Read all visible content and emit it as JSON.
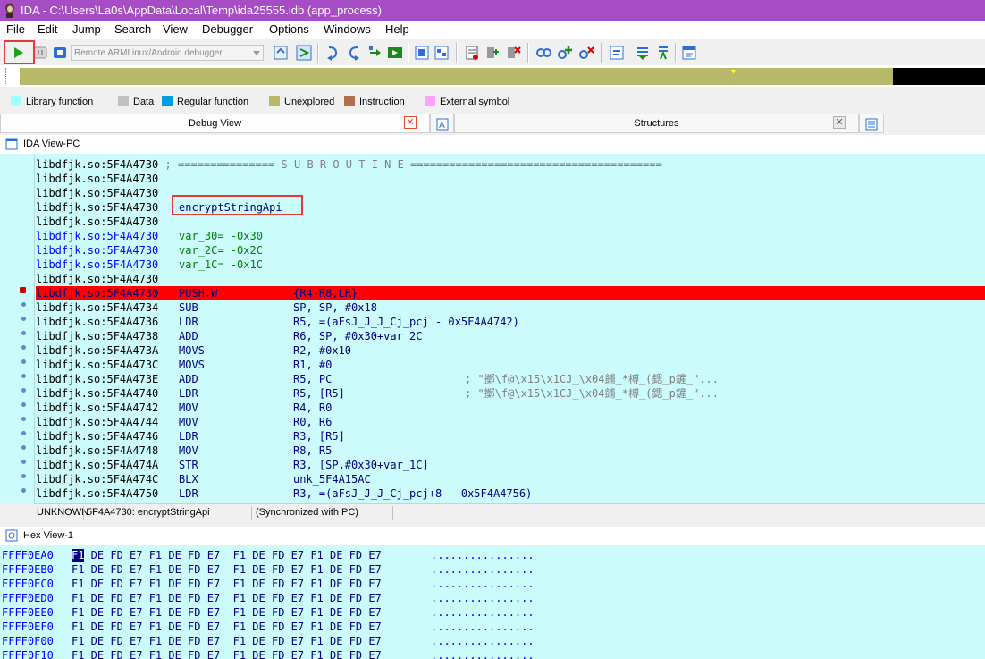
{
  "window": {
    "title": "IDA - C:\\Users\\La0s\\AppData\\Local\\Temp\\ida25555.idb (app_process)"
  },
  "menu": [
    "File",
    "Edit",
    "Jump",
    "Search",
    "View",
    "Debugger",
    "Options",
    "Windows",
    "Help"
  ],
  "toolbar": {
    "debugger_select": "Remote ARMLinux/Android debugger",
    "icons": [
      "play-icon",
      "pause-icon",
      "stop-icon",
      "attach-icon",
      "step-into-icon",
      "step-over-icon",
      "run-to-cursor-icon",
      "step-out-icon",
      "run-until-return-icon",
      "breakpoint-list-icon",
      "threads-icon",
      "modules-icon",
      "add-breakpoint-icon",
      "delete-breakpoint-icon",
      "watch-icon",
      "add-watch-icon",
      "delete-watch-icon",
      "trace-icon",
      "instruction-trace-icon",
      "function-trace-icon",
      "trace-window-icon"
    ]
  },
  "legend": [
    {
      "label": "Library function",
      "color": "#a0ffff"
    },
    {
      "label": "Data",
      "color": "#c0c0c0"
    },
    {
      "label": "Regular function",
      "color": "#00a0e0"
    },
    {
      "label": "Unexplored",
      "color": "#b8b86a"
    },
    {
      "label": "Instruction",
      "color": "#b07050"
    },
    {
      "label": "External symbol",
      "color": "#ffa0ff"
    }
  ],
  "tabs": {
    "debug_view": "Debug View",
    "structures": "Structures"
  },
  "ida_view": {
    "title": "IDA View-PC",
    "lines": [
      {
        "addr": "libdfjk.so:5F4A4730",
        "text": "; =============== S U B R O U T I N E ======================================="
      },
      {
        "addr": "libdfjk.so:5F4A4730"
      },
      {
        "addr": "libdfjk.so:5F4A4730"
      },
      {
        "addr": "libdfjk.so:5F4A4730",
        "label": "encryptStringApi"
      },
      {
        "addr": "libdfjk.so:5F4A4730"
      },
      {
        "addr": "libdfjk.so:5F4A4730",
        "var": "var_30",
        "val": "= -0x30"
      },
      {
        "addr": "libdfjk.so:5F4A4730",
        "var": "var_2C",
        "val": "= -0x2C"
      },
      {
        "addr": "libdfjk.so:5F4A4730",
        "var": "var_1C",
        "val": "= -0x1C"
      },
      {
        "addr": "libdfjk.so:5F4A4730"
      },
      {
        "addr": "libdfjk.so:5F4A4730",
        "mn": "PUSH.W",
        "op": "{R4-R8,LR}",
        "bp": true
      },
      {
        "addr": "libdfjk.so:5F4A4734",
        "mn": "SUB",
        "op": "SP, SP, #0x18"
      },
      {
        "addr": "libdfjk.so:5F4A4736",
        "mn": "LDR",
        "op": "R5, =(aFsJ_J_J_Cj_pcj - 0x5F4A4742)"
      },
      {
        "addr": "libdfjk.so:5F4A4738",
        "mn": "ADD",
        "op": "R6, SP, #0x30+var_2C"
      },
      {
        "addr": "libdfjk.so:5F4A473A",
        "mn": "MOVS",
        "op": "R2, #0x10"
      },
      {
        "addr": "libdfjk.so:5F4A473C",
        "mn": "MOVS",
        "op": "R1, #0"
      },
      {
        "addr": "libdfjk.so:5F4A473E",
        "mn": "ADD",
        "op": "R5, PC",
        "cm": "; \"擲\\f@\\x15\\x1CJ_\\x04餔_*榑_(鍶_p鏟_\"..."
      },
      {
        "addr": "libdfjk.so:5F4A4740",
        "mn": "LDR",
        "op": "R5, [R5]",
        "cm": "; \"擲\\f@\\x15\\x1CJ_\\x04餔_*榑_(鍶_p鏟_\"..."
      },
      {
        "addr": "libdfjk.so:5F4A4742",
        "mn": "MOV",
        "op": "R4, R0"
      },
      {
        "addr": "libdfjk.so:5F4A4744",
        "mn": "MOV",
        "op": "R0, R6"
      },
      {
        "addr": "libdfjk.so:5F4A4746",
        "mn": "LDR",
        "op": "R3, [R5]"
      },
      {
        "addr": "libdfjk.so:5F4A4748",
        "mn": "MOV",
        "op": "R8, R5"
      },
      {
        "addr": "libdfjk.so:5F4A474A",
        "mn": "STR",
        "op": "R3, [SP,#0x30+var_1C]"
      },
      {
        "addr": "libdfjk.so:5F4A474C",
        "mn": "BLX",
        "op": "unk_5F4A15AC"
      },
      {
        "addr": "libdfjk.so:5F4A4750",
        "mn": "LDR",
        "op": "R3, =(aFsJ_J_J_Cj_pcj+8 - 0x5F4A4756)"
      }
    ],
    "status": {
      "segment": "UNKNOWN",
      "location": "5F4A4730: encryptStringApi",
      "sync": "(Synchronized with PC)"
    }
  },
  "hex_view": {
    "title": "Hex View-1",
    "rows": [
      {
        "addr": "FFFF0EA0",
        "bytes": "F1 DE FD E7 F1 DE FD E7  F1 DE FD E7 F1 DE FD E7",
        "ascii": "................"
      },
      {
        "addr": "FFFF0EB0",
        "bytes": "F1 DE FD E7 F1 DE FD E7  F1 DE FD E7 F1 DE FD E7",
        "ascii": "................"
      },
      {
        "addr": "FFFF0EC0",
        "bytes": "F1 DE FD E7 F1 DE FD E7  F1 DE FD E7 F1 DE FD E7",
        "ascii": "................"
      },
      {
        "addr": "FFFF0ED0",
        "bytes": "F1 DE FD E7 F1 DE FD E7  F1 DE FD E7 F1 DE FD E7",
        "ascii": "................"
      },
      {
        "addr": "FFFF0EE0",
        "bytes": "F1 DE FD E7 F1 DE FD E7  F1 DE FD E7 F1 DE FD E7",
        "ascii": "................"
      },
      {
        "addr": "FFFF0EF0",
        "bytes": "F1 DE FD E7 F1 DE FD E7  F1 DE FD E7 F1 DE FD E7",
        "ascii": "................"
      },
      {
        "addr": "FFFF0F00",
        "bytes": "F1 DE FD E7 F1 DE FD E7  F1 DE FD E7 F1 DE FD E7",
        "ascii": "................"
      },
      {
        "addr": "FFFF0F10",
        "bytes": "F1 DE FD E7 F1 DE FD E7  F1 DE FD E7 F1 DE FD E7",
        "ascii": "................"
      }
    ]
  }
}
